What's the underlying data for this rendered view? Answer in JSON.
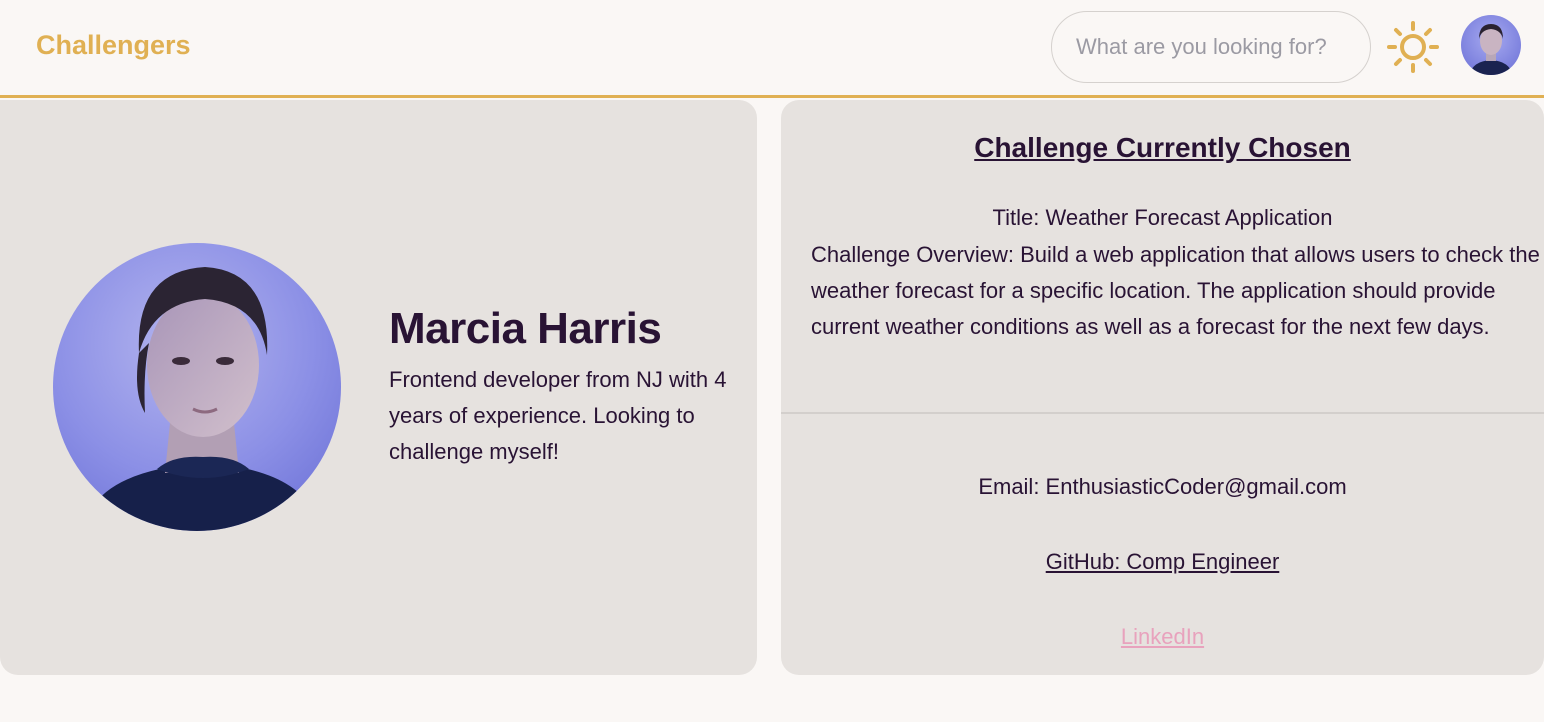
{
  "navbar": {
    "brand": "Challengers",
    "search_placeholder": "What are you looking for?",
    "theme_icon": "sun-icon",
    "accent_color": "#e0b053"
  },
  "profile": {
    "name": "Marcia Harris",
    "bio": "Frontend developer from NJ with 4 years of experience. Looking to challenge myself!"
  },
  "challenge": {
    "heading": "Challenge Currently Chosen",
    "title": "Title: Weather Forecast Application",
    "overview": "Challenge Overview: Build a web application that allows users to check the weather forecast for a specific location. The application should provide current weather conditions as well as a forecast for the next few days.",
    "email": "Email: EnthusiasticCoder@gmail.com",
    "github": "GitHub: Comp Engineer",
    "linkedin": "LinkedIn"
  }
}
